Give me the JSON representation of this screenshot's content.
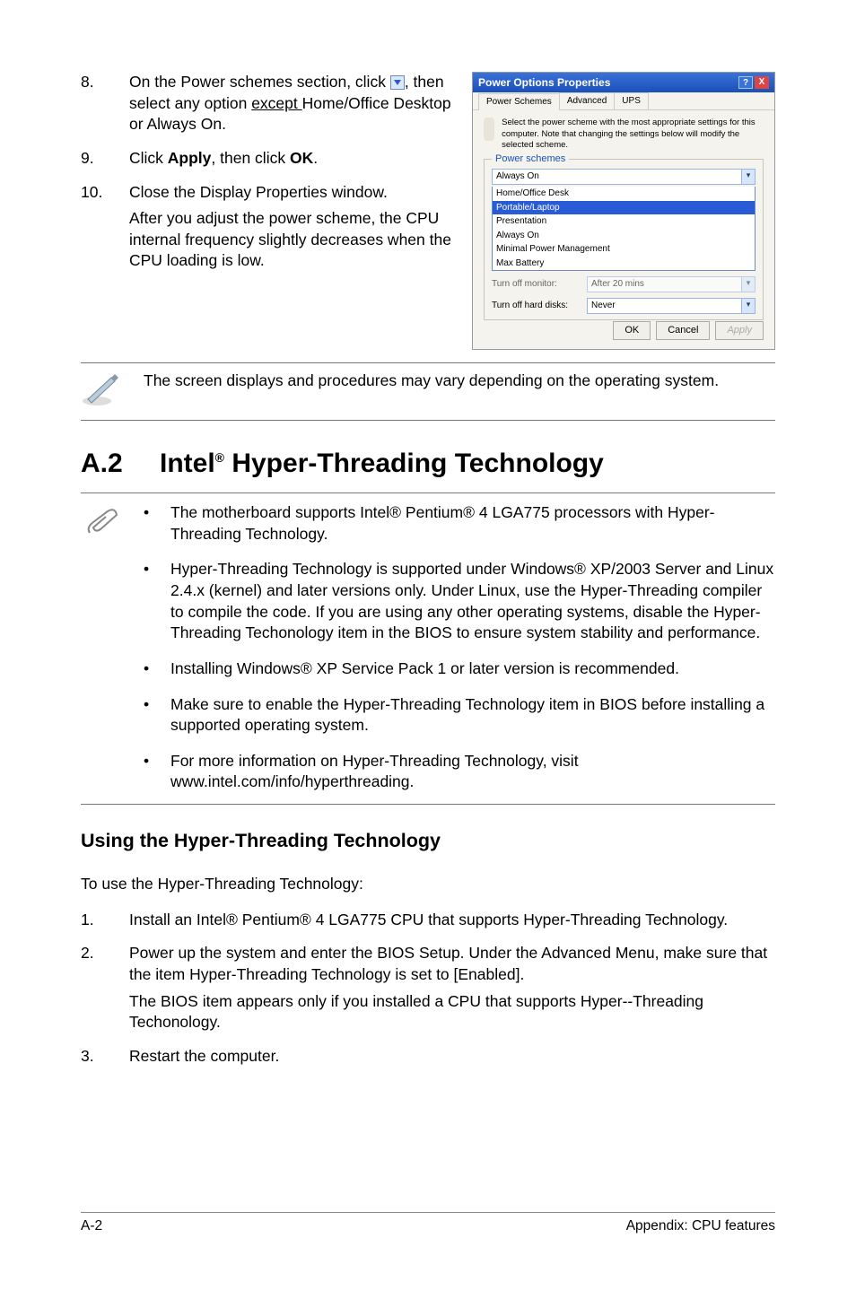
{
  "steps_top": [
    {
      "num": "8.",
      "body_parts": [
        {
          "text": "On the Power schemes section, click "
        },
        {
          "icon": "dropdown-icon"
        },
        {
          "text": ", then select any option "
        },
        {
          "underline": "except "
        },
        {
          "text": "Home/Office Desktop or Always On."
        }
      ]
    },
    {
      "num": "9.",
      "body_parts": [
        {
          "text": "Click "
        },
        {
          "bold": "Apply"
        },
        {
          "text": ", then click "
        },
        {
          "bold": "OK"
        },
        {
          "text": "."
        }
      ]
    },
    {
      "num": "10.",
      "body_parts": [
        {
          "text": "Close the Display Properties window."
        }
      ],
      "extra": "After you adjust the power scheme, the CPU internal frequency slightly decreases when the CPU loading is low."
    }
  ],
  "screenshot": {
    "title": "Power Options Properties",
    "tabs": [
      "Power Schemes",
      "Advanced",
      "UPS"
    ],
    "desc": "Select the power scheme with the most appropriate settings for this computer. Note that changing the settings below will modify the selected scheme.",
    "group_title": "Power schemes",
    "combo_value": "Always On",
    "list": [
      "Home/Office Desk",
      "Portable/Laptop",
      "Presentation",
      "Always On",
      "Minimal Power Management",
      "Max Battery"
    ],
    "list_highlight": 1,
    "field1_label": "Turn off monitor:",
    "field1_value": "After 20 mins",
    "field2_label": "Turn off hard disks:",
    "field2_value": "Never",
    "buttons": [
      "OK",
      "Cancel",
      "Apply"
    ]
  },
  "note_text": "The screen displays and procedures may vary depending on the operating system.",
  "section": {
    "num": "A.2",
    "title_pre": "Intel",
    "title_post": " Hyper-Threading Technology"
  },
  "tips": [
    "The motherboard supports  Intel® Pentium® 4 LGA775 processors with Hyper-Threading Technology.",
    "Hyper-Threading Technology is supported under Windows® XP/2003 Server and Linux 2.4.x (kernel) and later versions only. Under Linux, use the Hyper-Threading compiler to compile the code. If you are using any other operating systems, disable the Hyper-Threading Techonology item in the BIOS to ensure system stability and performance.",
    "Installing Windows® XP Service Pack 1 or later version is recommended.",
    "Make sure to enable the Hyper-Threading Technology item in BIOS before installing a supported operating system.",
    "For more information on Hyper-Threading Technology, visit  www.intel.com/info/hyperthreading."
  ],
  "subheading": "Using the Hyper-Threading Technology",
  "subpara": "To use the Hyper-Threading Technology:",
  "steps_bottom": [
    {
      "num": "1.",
      "text": "Install an Intel® Pentium® 4 LGA775 CPU that supports Hyper-Threading Technology."
    },
    {
      "num": "2.",
      "text": "Power up the system and enter the BIOS Setup. Under the Advanced Menu, make sure that the item Hyper-Threading Technology is set to [Enabled].",
      "extra": "The BIOS item appears only if you installed a CPU that supports Hyper--Threading Techonology."
    },
    {
      "num": "3.",
      "text": "Restart the computer."
    }
  ],
  "footer": {
    "left": "A-2",
    "right": "Appendix: CPU features"
  },
  "bullet_char": "•"
}
